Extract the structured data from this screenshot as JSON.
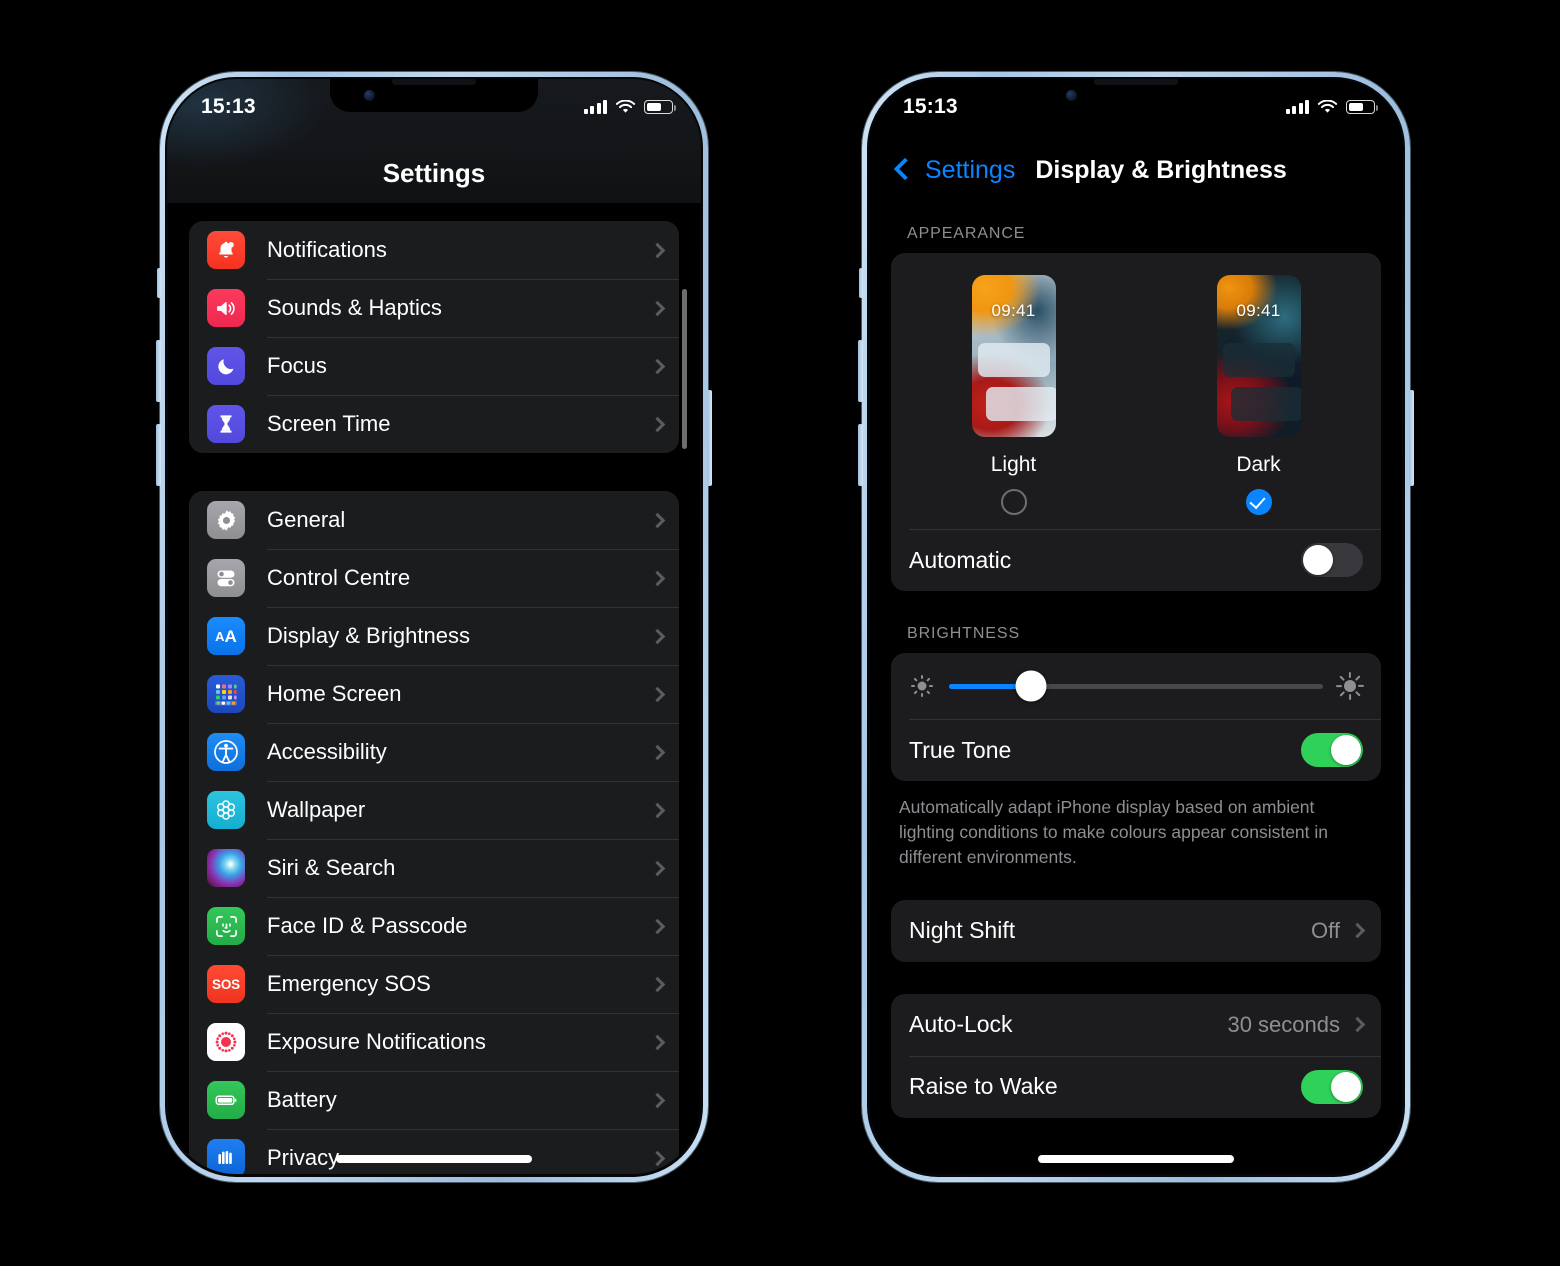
{
  "status_bar": {
    "time": "15:13",
    "signal": "signal-bars",
    "wifi": "wifi",
    "battery_level": "55"
  },
  "left_phone": {
    "title": "Settings",
    "groups": [
      {
        "items": [
          {
            "label": "Notifications",
            "icon": "bell-icon"
          },
          {
            "label": "Sounds & Haptics",
            "icon": "speaker-icon"
          },
          {
            "label": "Focus",
            "icon": "moon-icon"
          },
          {
            "label": "Screen Time",
            "icon": "hourglass-icon"
          }
        ]
      },
      {
        "items": [
          {
            "label": "General",
            "icon": "gear-icon"
          },
          {
            "label": "Control Centre",
            "icon": "toggles-icon"
          },
          {
            "label": "Display & Brightness",
            "icon": "aa-icon"
          },
          {
            "label": "Home Screen",
            "icon": "app-grid-icon"
          },
          {
            "label": "Accessibility",
            "icon": "accessibility-icon"
          },
          {
            "label": "Wallpaper",
            "icon": "flower-icon"
          },
          {
            "label": "Siri & Search",
            "icon": "siri-icon"
          },
          {
            "label": "Face ID & Passcode",
            "icon": "face-id-icon"
          },
          {
            "label": "Emergency SOS",
            "icon": "sos-icon"
          },
          {
            "label": "Exposure Notifications",
            "icon": "exposure-icon"
          },
          {
            "label": "Battery",
            "icon": "battery-icon"
          },
          {
            "label": "Privacy",
            "icon": "hand-icon"
          }
        ]
      }
    ]
  },
  "right_phone": {
    "back_label": "Settings",
    "title": "Display & Brightness",
    "appearance": {
      "header": "APPEARANCE",
      "options": [
        {
          "name": "Light",
          "preview_time": "09:41",
          "selected": false
        },
        {
          "name": "Dark",
          "preview_time": "09:41",
          "selected": true
        }
      ],
      "automatic_label": "Automatic",
      "automatic_on": false
    },
    "brightness": {
      "header": "BRIGHTNESS",
      "slider_percent": 22,
      "true_tone_label": "True Tone",
      "true_tone_on": true,
      "true_tone_footnote": "Automatically adapt iPhone display based on ambient lighting conditions to make colours appear consistent in different environments.",
      "night_shift_label": "Night Shift",
      "night_shift_value": "Off"
    },
    "lock": {
      "auto_lock_label": "Auto-Lock",
      "auto_lock_value": "30 seconds",
      "raise_to_wake_label": "Raise to Wake",
      "raise_to_wake_on": true
    }
  },
  "colors": {
    "accent": "#0a84ff",
    "toggle_on": "#30d158",
    "toggle_off": "#39393d",
    "frame": "#b7d4ec"
  }
}
